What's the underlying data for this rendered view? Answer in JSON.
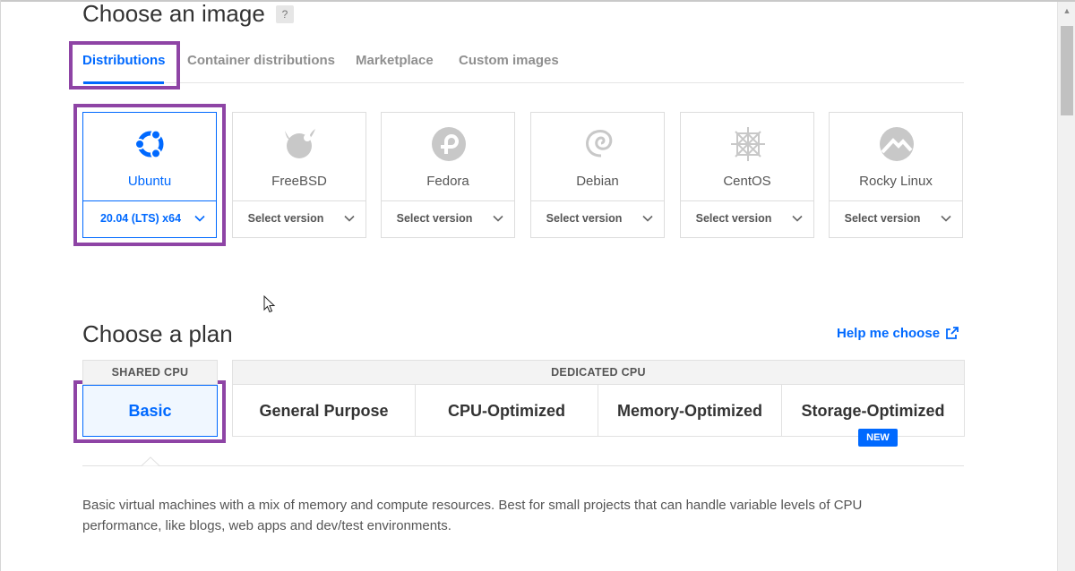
{
  "image_section": {
    "title": "Choose an image",
    "help_badge": "?",
    "tabs": [
      {
        "label": "Distributions",
        "active": true
      },
      {
        "label": "Container distributions",
        "active": false
      },
      {
        "label": "Marketplace",
        "active": false
      },
      {
        "label": "Custom images",
        "active": false
      }
    ],
    "distros": [
      {
        "name": "Ubuntu",
        "version": "20.04 (LTS) x64",
        "selected": true,
        "icon": "ubuntu-logo-icon"
      },
      {
        "name": "FreeBSD",
        "version": "Select version",
        "selected": false,
        "icon": "freebsd-logo-icon"
      },
      {
        "name": "Fedora",
        "version": "Select version",
        "selected": false,
        "icon": "fedora-logo-icon"
      },
      {
        "name": "Debian",
        "version": "Select version",
        "selected": false,
        "icon": "debian-logo-icon"
      },
      {
        "name": "CentOS",
        "version": "Select version",
        "selected": false,
        "icon": "centos-logo-icon"
      },
      {
        "name": "Rocky Linux",
        "version": "Select version",
        "selected": false,
        "icon": "rocky-linux-logo-icon"
      }
    ]
  },
  "plan_section": {
    "title": "Choose a plan",
    "help_link": "Help me choose",
    "shared_header": "SHARED CPU",
    "dedicated_header": "DEDICATED CPU",
    "plans": {
      "basic": "Basic",
      "general_purpose": "General Purpose",
      "cpu_optimized": "CPU-Optimized",
      "memory_optimized": "Memory-Optimized",
      "storage_optimized": "Storage-Optimized"
    },
    "new_badge": "NEW",
    "description": "Basic virtual machines with a mix of memory and compute resources. Best for small projects that can handle variable levels of CPU performance, like blogs, web apps and dev/test environments."
  },
  "colors": {
    "accent": "#0069ff",
    "highlight": "#8e44a5",
    "muted_text": "#8f8f8f"
  }
}
